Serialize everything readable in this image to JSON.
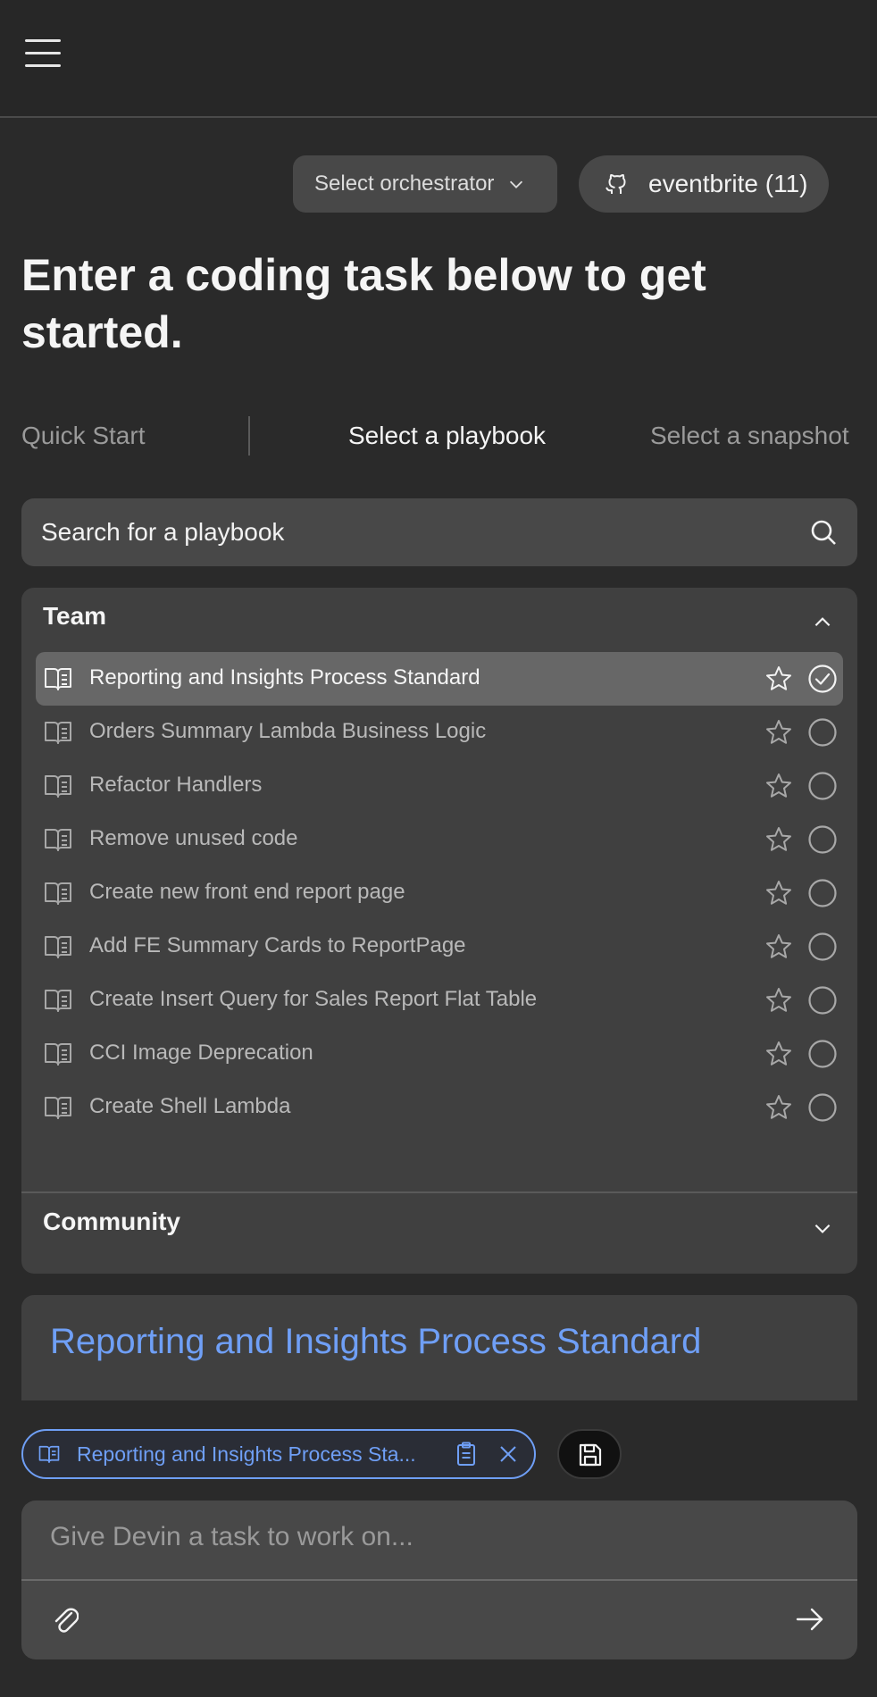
{
  "header": {
    "menu_icon": "hamburger-menu-icon"
  },
  "toolbar": {
    "orchestrator_label": "Select orchestrator",
    "repo_label": "eventbrite (11)",
    "repo_icon": "github-icon"
  },
  "headline": "Enter a coding task below to get started.",
  "tabs": {
    "quick_start": "Quick Start",
    "select_playbook": "Select a playbook",
    "select_snapshot": "Select a snapshot"
  },
  "search": {
    "placeholder": "Search for a playbook"
  },
  "sections": {
    "team": {
      "title": "Team",
      "expanded": true,
      "items": [
        {
          "label": "Reporting and Insights Process Standard",
          "selected": true
        },
        {
          "label": "Orders Summary Lambda Business Logic",
          "selected": false
        },
        {
          "label": "Refactor Handlers",
          "selected": false
        },
        {
          "label": "Remove unused code",
          "selected": false
        },
        {
          "label": "Create new front end report page",
          "selected": false
        },
        {
          "label": "Add FE Summary Cards to ReportPage",
          "selected": false
        },
        {
          "label": "Create Insert Query for Sales Report Flat Table",
          "selected": false
        },
        {
          "label": "CCI Image Deprecation",
          "selected": false
        },
        {
          "label": "Create Shell Lambda",
          "selected": false
        }
      ]
    },
    "community": {
      "title": "Community",
      "expanded": false
    }
  },
  "preview": {
    "title": "Reporting and Insights Process Standard"
  },
  "chip": {
    "label": "Reporting and Insights Process Sta..."
  },
  "composer": {
    "placeholder": "Give Devin a task to work on..."
  },
  "colors": {
    "background": "#2a2a2a",
    "surface": "#404040",
    "control": "#484848",
    "selected_row": "#676767",
    "accent": "#6f9ff6"
  }
}
